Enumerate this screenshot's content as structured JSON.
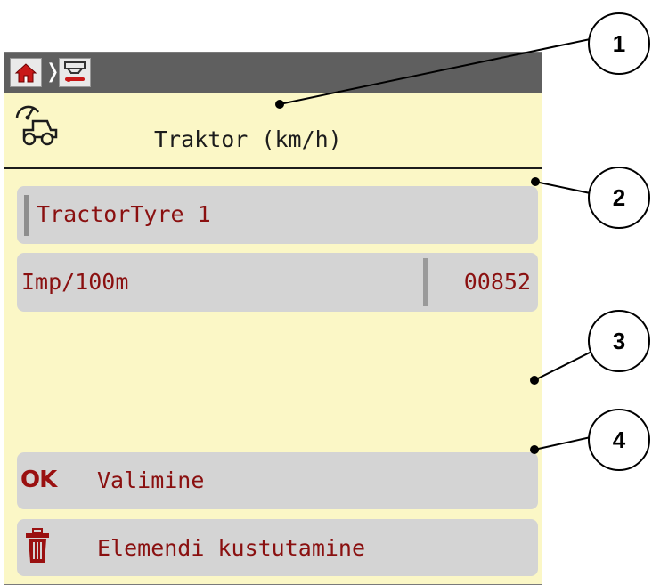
{
  "header": {
    "breadcrumb": [
      {
        "name": "home-icon"
      },
      {
        "name": "spreader-settings-icon"
      }
    ],
    "separator": "❭"
  },
  "title": {
    "icon": "tractor-speed-icon",
    "text": "Traktor (km/h)"
  },
  "rows": {
    "tyre": {
      "label": "TractorTyre 1"
    },
    "impulses": {
      "label": "Imp/100m",
      "value": "00852"
    }
  },
  "actions": {
    "select": {
      "key": "OK",
      "label": "Valimine"
    },
    "delete": {
      "icon": "trash-icon",
      "label": "Elemendi kustutamine"
    }
  },
  "callouts": [
    "1",
    "2",
    "3",
    "4"
  ],
  "colors": {
    "screen_bg": "#fbf7c6",
    "topbar": "#5f5f5f",
    "row_bg": "#d4d4d4",
    "text_red": "#8a1010"
  }
}
